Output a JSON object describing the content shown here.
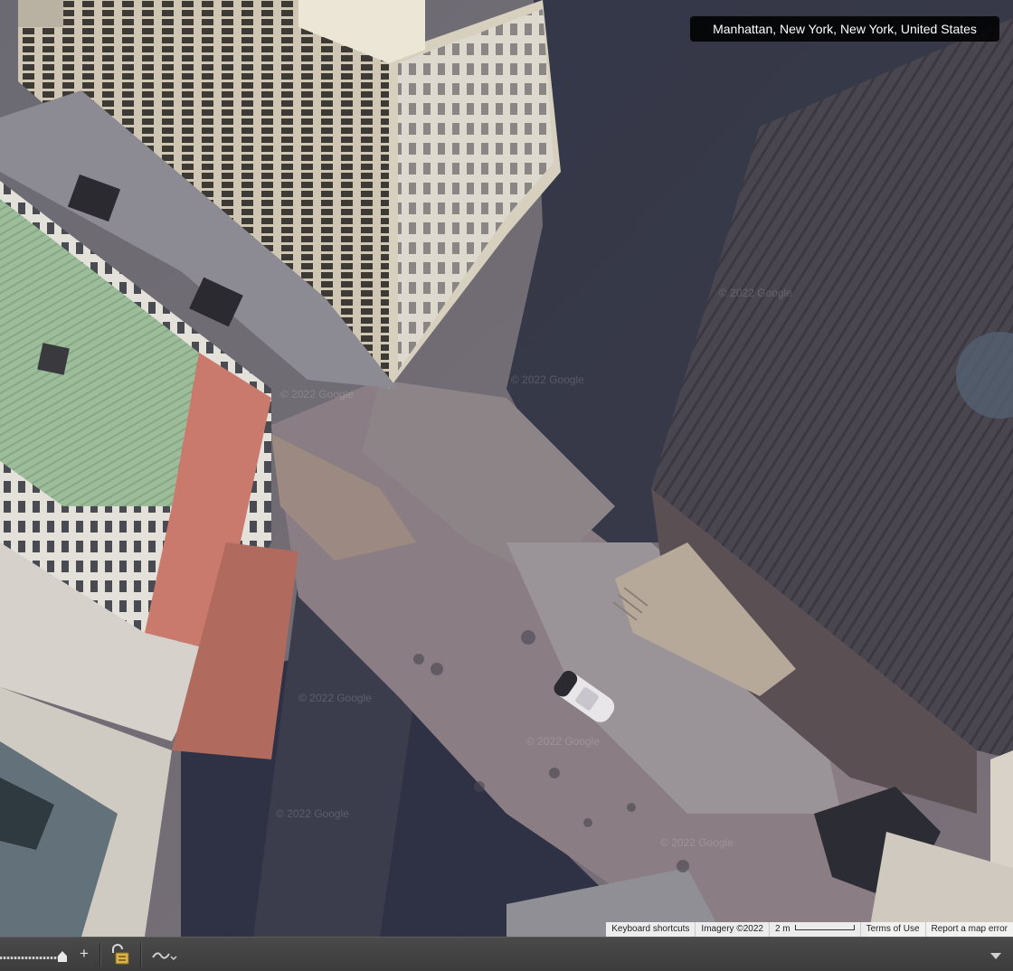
{
  "location": "Manhattan, New York, New York, United States",
  "attribution": {
    "keyboard_shortcuts": "Keyboard shortcuts",
    "imagery": "Imagery ©2022",
    "scale_label": "2 m",
    "terms": "Terms of Use",
    "report": "Report a map error"
  },
  "watermark": "© 2022 Google",
  "toolbar": {
    "zoom_in_symbol": "+",
    "icons": [
      "zoom-slider",
      "plus-icon",
      "lock-icon",
      "path-icon",
      "chevron-down-icon"
    ]
  },
  "colors": {
    "label_bg": "#000000",
    "toolbar_bg": "#3c3c3c",
    "attribution_bg": "#f5f5f5"
  }
}
